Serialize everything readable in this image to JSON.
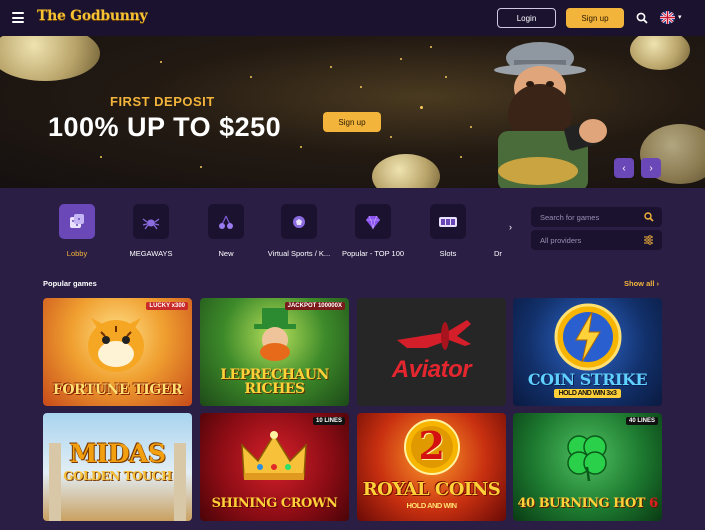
{
  "header": {
    "logo_text": "The Godbunny",
    "login_label": "Login",
    "signup_label": "Sign up",
    "language_flag": "uk-flag-icon"
  },
  "banner": {
    "title": "FIRST DEPOSIT",
    "amount": "100% UP TO $250",
    "signup_label": "Sign up",
    "prev_arrow": "‹",
    "next_arrow": "›"
  },
  "categories": [
    {
      "label": "Lobby",
      "icon": "dice-icon",
      "active": true
    },
    {
      "label": "MEGAWAYS",
      "icon": "spider-icon",
      "active": false
    },
    {
      "label": "New",
      "icon": "cherries-icon",
      "active": false
    },
    {
      "label": "Virtual Sports / K...",
      "icon": "virtual-sports-icon",
      "active": false
    },
    {
      "label": "Popular - TOP 100",
      "icon": "diamond-icon",
      "active": false
    },
    {
      "label": "Slots",
      "icon": "slot-machine-icon",
      "active": false
    },
    {
      "label": "Dr",
      "icon": "more-icon",
      "active": false
    }
  ],
  "search": {
    "placeholder": "Search for games",
    "providers_label": "All providers"
  },
  "games_section": {
    "title": "Popular games",
    "show_all_label": "Show all ›"
  },
  "games": [
    {
      "title": "FORTUNE TIGER",
      "badge": "LUCKY x300"
    },
    {
      "title": "LEPRECHAUN RICHES",
      "badge": "JACKPOT 100000X"
    },
    {
      "title": "Aviator",
      "badge": ""
    },
    {
      "title": "COIN STRIKE",
      "subtitle": "HOLD AND WIN 3x3",
      "badge": ""
    },
    {
      "title": "MIDAS",
      "subtitle": "GOLDEN TOUCH",
      "badge": ""
    },
    {
      "title": "SHINING CROWN",
      "badge": "10 LINES"
    },
    {
      "title": "ROYAL COINS",
      "subtitle": "HOLD AND WIN",
      "number": "2",
      "badge": ""
    },
    {
      "title": "40 BURNING HOT",
      "number": "6",
      "badge": "40 LINES"
    }
  ],
  "colors": {
    "accent": "#f3b43b",
    "header_bg": "#1b1230",
    "page_bg": "#2a1e45",
    "active_category": "#6b48b8"
  }
}
